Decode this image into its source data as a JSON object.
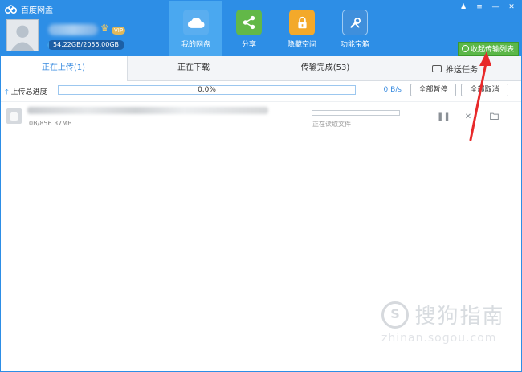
{
  "app": {
    "title": "百度网盘"
  },
  "user": {
    "vip_badge": "VIP",
    "quota_text": "54.22GB/2055.00GB",
    "quota_used_fraction": 0.026
  },
  "nav": [
    {
      "label": "我的网盘",
      "icon": "cloud-icon",
      "color": "#5aaef0"
    },
    {
      "label": "分享",
      "icon": "share-icon",
      "color": "#62b848"
    },
    {
      "label": "隐藏空间",
      "icon": "lock-icon",
      "color": "#f3a92a"
    },
    {
      "label": "功能宝箱",
      "icon": "tools-icon",
      "color": "#3f8fdc"
    }
  ],
  "window_buttons": {
    "skin": "♟",
    "menu": "≡",
    "minimize": "—",
    "close": "✕"
  },
  "collapse_button": {
    "label": "收起传输列表"
  },
  "tabs": [
    {
      "label": "正在上传(1)"
    },
    {
      "label": "正在下载"
    },
    {
      "label": "传输完成(53)"
    }
  ],
  "push_tab": {
    "label": "推送任务"
  },
  "summary": {
    "label": "上传总进度",
    "progress_text": "0.0%",
    "progress": 0.0,
    "speed": "0 B/s",
    "pause_all": "全部暂停",
    "cancel_all": "全部取消"
  },
  "transfer": {
    "size": "0B/856.37MB",
    "status": "正在读取文件",
    "progress": 0.0
  },
  "watermark": {
    "brand": "搜狗指南",
    "url": "zhinan.sogou.com"
  },
  "colors": {
    "header": "#2d8ee6",
    "accent": "#3a8ce0",
    "green": "#5bb748",
    "annotation": "#e8292a"
  }
}
